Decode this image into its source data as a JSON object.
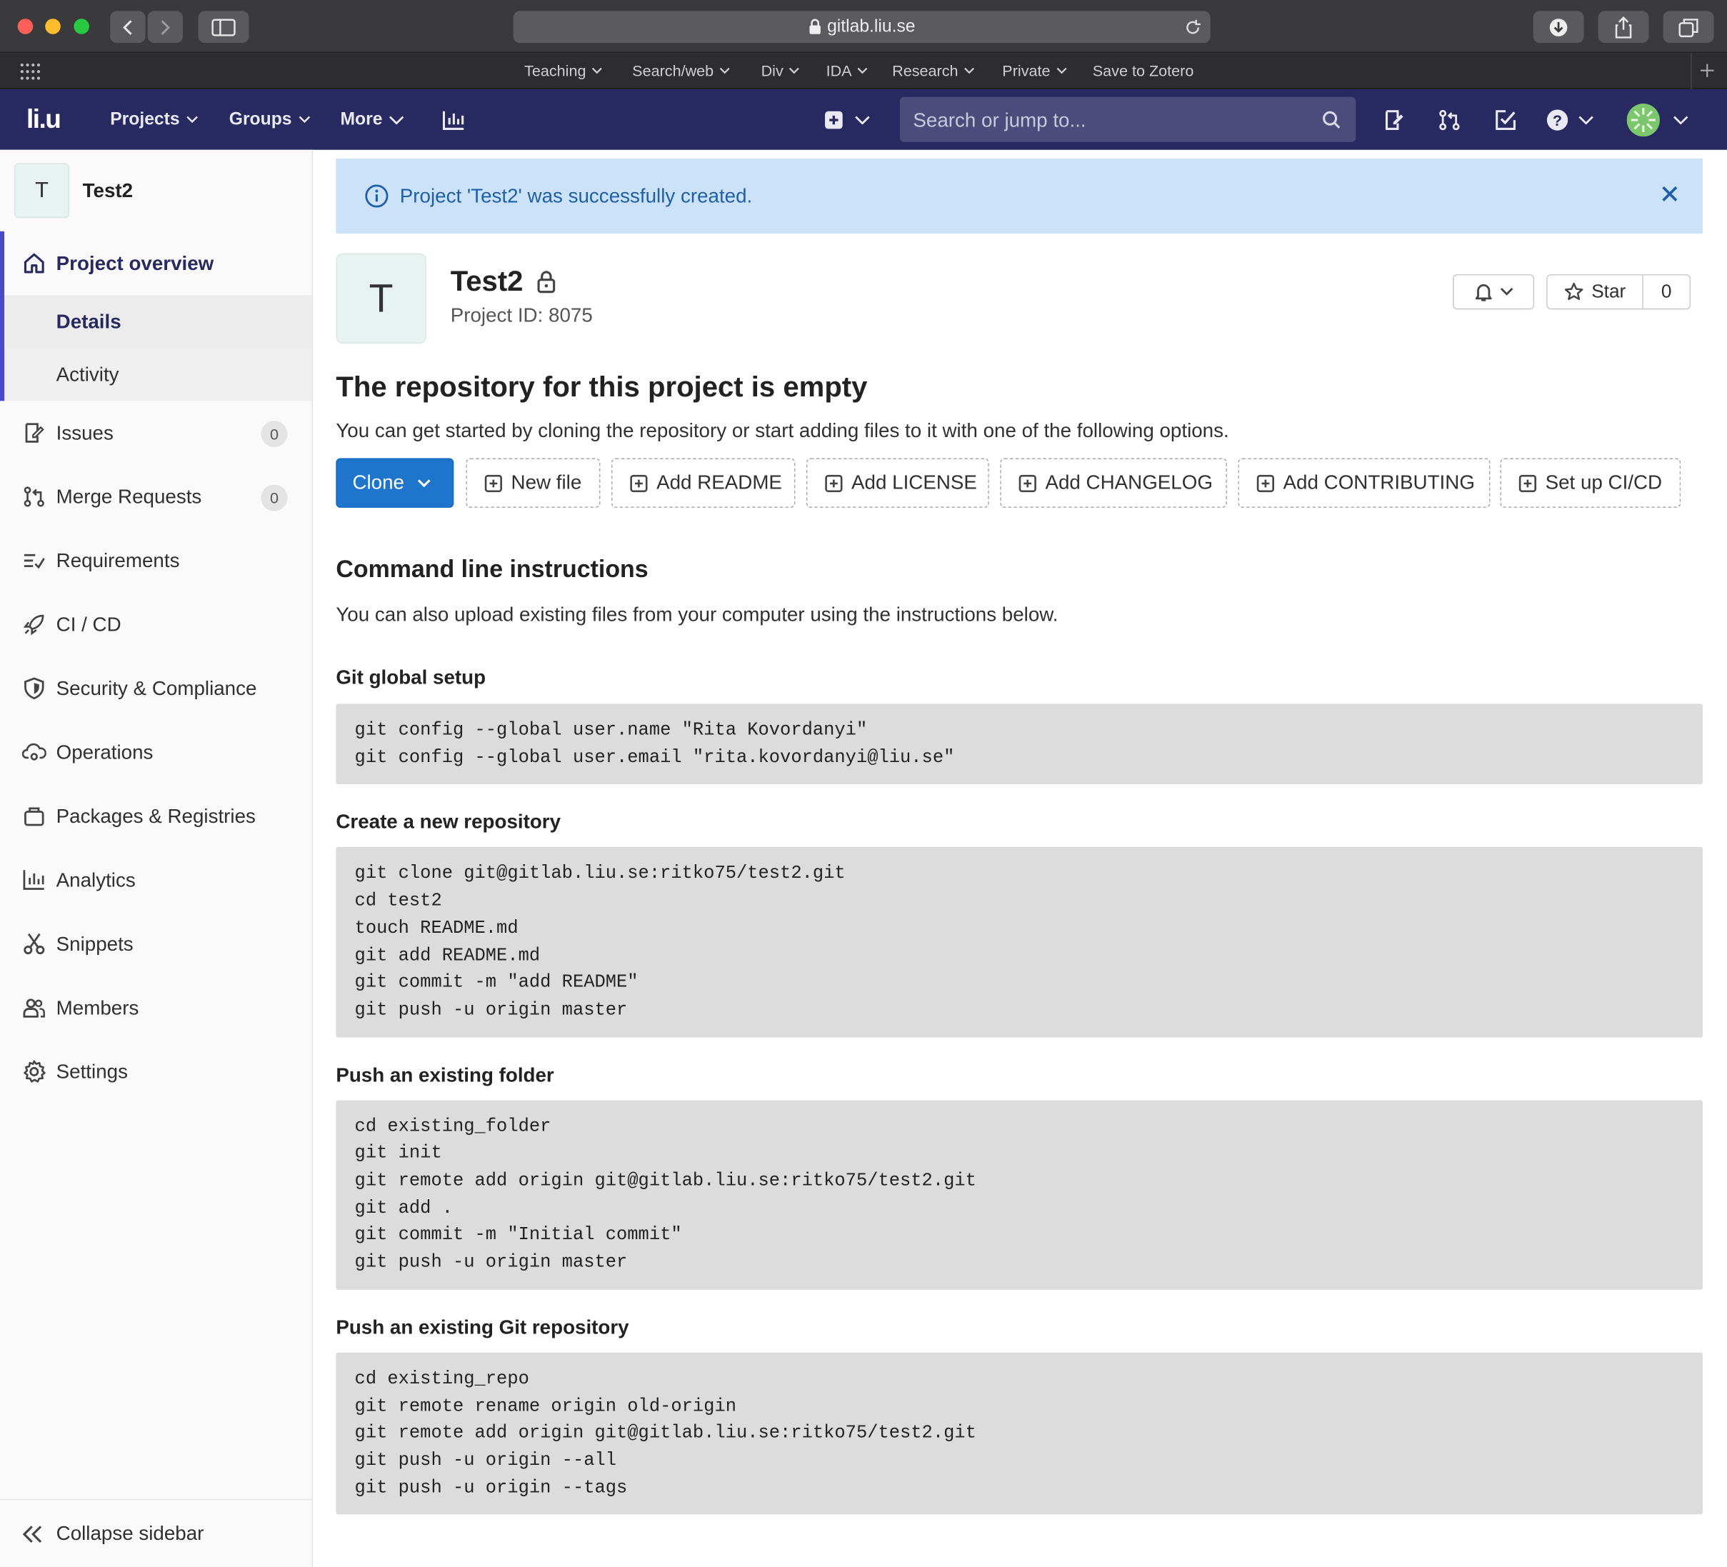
{
  "browser": {
    "url": "gitlab.liu.se",
    "favorites": [
      "Teaching",
      "Search/web",
      "Div",
      "IDA",
      "Research",
      "Private",
      "Save to Zotero"
    ]
  },
  "gitlab_nav": {
    "logo": "li.u",
    "projects": "Projects",
    "groups": "Groups",
    "more": "More",
    "search_placeholder": "Search or jump to..."
  },
  "sidebar": {
    "project_avatar": "T",
    "project_name": "Test2",
    "overview": "Project overview",
    "details": "Details",
    "activity": "Activity",
    "issues": "Issues",
    "issues_count": "0",
    "merge_requests": "Merge Requests",
    "merge_requests_count": "0",
    "requirements": "Requirements",
    "cicd": "CI / CD",
    "security": "Security & Compliance",
    "operations": "Operations",
    "packages": "Packages & Registries",
    "analytics": "Analytics",
    "snippets": "Snippets",
    "members": "Members",
    "settings": "Settings",
    "collapse": "Collapse sidebar"
  },
  "flash": {
    "message": "Project 'Test2' was successfully created."
  },
  "project": {
    "avatar": "T",
    "title": "Test2",
    "id_text": "Project ID: 8075",
    "star_label": "Star",
    "star_count": "0"
  },
  "empty_repo": {
    "heading": "The repository for this project is empty",
    "lead": "You can get started by cloning the repository or start adding files to it with one of the following options.",
    "clone": "Clone",
    "new_file": "New file",
    "add_readme": "Add README",
    "add_license": "Add LICENSE",
    "add_changelog": "Add CHANGELOG",
    "add_contributing": "Add CONTRIBUTING",
    "setup_cicd": "Set up CI/CD"
  },
  "cli": {
    "heading": "Command line instructions",
    "intro": "You can also upload existing files from your computer using the instructions below.",
    "global_setup_title": "Git global setup",
    "global_setup_code": "git config --global user.name \"Rita Kovordanyi\"\ngit config --global user.email \"rita.kovordanyi@liu.se\"",
    "new_repo_title": "Create a new repository",
    "new_repo_code": "git clone git@gitlab.liu.se:ritko75/test2.git\ncd test2\ntouch README.md\ngit add README.md\ngit commit -m \"add README\"\ngit push -u origin master",
    "existing_folder_title": "Push an existing folder",
    "existing_folder_code": "cd existing_folder\ngit init\ngit remote add origin git@gitlab.liu.se:ritko75/test2.git\ngit add .\ngit commit -m \"Initial commit\"\ngit push -u origin master",
    "existing_repo_title": "Push an existing Git repository",
    "existing_repo_code": "cd existing_repo\ngit remote rename origin old-origin\ngit remote add origin git@gitlab.liu.se:ritko75/test2.git\ngit push -u origin --all\ngit push -u origin --tags"
  },
  "colors": {
    "navbar": "#292961",
    "accent": "#1f75cb",
    "flash_bg": "#cbe2f9"
  }
}
